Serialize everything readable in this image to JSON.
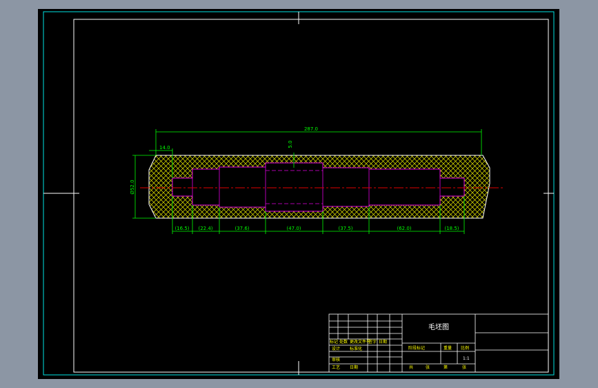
{
  "drawing": {
    "title": "毛坯图",
    "scale": "1:1",
    "background": "#000000",
    "frame_color": "#00e5e5",
    "part_outline_color": "#ffffff",
    "inner_shaft_color": "#e000e0",
    "hatch_color": "#f0f000",
    "dimension_color": "#00ff00",
    "centerline_color": "#e00000"
  },
  "dimensions": {
    "overall_length": "287.0",
    "chamfer": "14.0",
    "diameter": "Ø52.0",
    "allowance": "5.0",
    "segments": [
      "(16.5)",
      "(22.4)",
      "(37.6)",
      "(47.0)",
      "(37.5)",
      "(62.0)",
      "(18.5)"
    ]
  },
  "title_block": {
    "labels": {
      "mark": "标记",
      "count": "处数",
      "change_doc": "更改文件号",
      "signature": "签字",
      "date": "日期",
      "design": "设计",
      "standardize": "标准化",
      "stage_mark": "阶段标记",
      "weight": "重量",
      "ratio": "比例",
      "audit": "审核",
      "process": "工艺",
      "date2": "日期",
      "total": "共",
      "sheet": "张",
      "page": "第",
      "page_unit": "张"
    }
  }
}
